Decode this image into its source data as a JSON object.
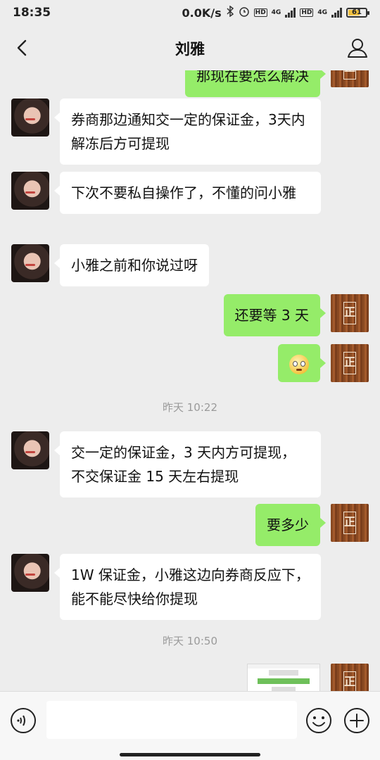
{
  "status_bar": {
    "time": "18:35",
    "network_speed": "0.0K/s",
    "network_label_1": "4G",
    "network_label_2": "4G",
    "hd_label": "HD",
    "battery_level": "61"
  },
  "header": {
    "title": "刘雅",
    "back_icon": "chevron-left-icon",
    "profile_icon": "person-icon"
  },
  "messages": [
    {
      "from": "me",
      "text": "那现在要怎么解决"
    },
    {
      "from": "contact",
      "text": "券商那边通知交一定的保证金，3天内解冻后方可提现"
    },
    {
      "from": "contact",
      "text": "下次不要私自操作了，不懂的问小雅"
    },
    {
      "from": "contact",
      "text": "小雅之前和你说过呀"
    },
    {
      "from": "me",
      "text": "还要等 3 天"
    },
    {
      "from": "me",
      "emoji": "astonished-face-icon"
    },
    {
      "timestamp": "昨天 10:22"
    },
    {
      "from": "contact",
      "text": "交一定的保证金，3 天内方可提现，不交保证金 15 天左右提现"
    },
    {
      "from": "me",
      "text": "要多少"
    },
    {
      "from": "contact",
      "text": "1W 保证金，小雅这边向券商反应下，能不能尽快给你提现"
    },
    {
      "timestamp": "昨天 10:50"
    },
    {
      "from": "me",
      "image": "screenshot-thumbnail"
    }
  ],
  "input_bar": {
    "value": "",
    "placeholder": ""
  },
  "colors": {
    "background": "#ededed",
    "outgoing_bubble": "#95ec69",
    "incoming_bubble": "#ffffff",
    "timestamp_text": "#9a9a9a"
  }
}
